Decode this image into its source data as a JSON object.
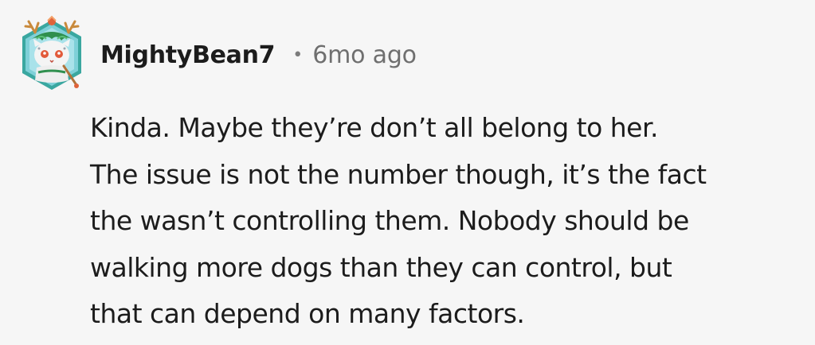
{
  "comment": {
    "author": "MightyBean7",
    "separator": "•",
    "timestamp": "6mo ago",
    "avatar_icon": "snow-leopard-avatar-icon",
    "body_lines": [
      "Kinda. Maybe they’re don’t all belong to her.",
      "The issue is not the number though, it’s the fact",
      "the wasn’t controlling them. Nobody should be",
      "walking more dogs than they can control, but",
      "that can depend on many factors."
    ]
  },
  "colors": {
    "background": "#f6f6f6",
    "text": "#1c1c1c",
    "meta_text": "#6f6f6f",
    "avatar_frame": "#3aa7a0"
  }
}
